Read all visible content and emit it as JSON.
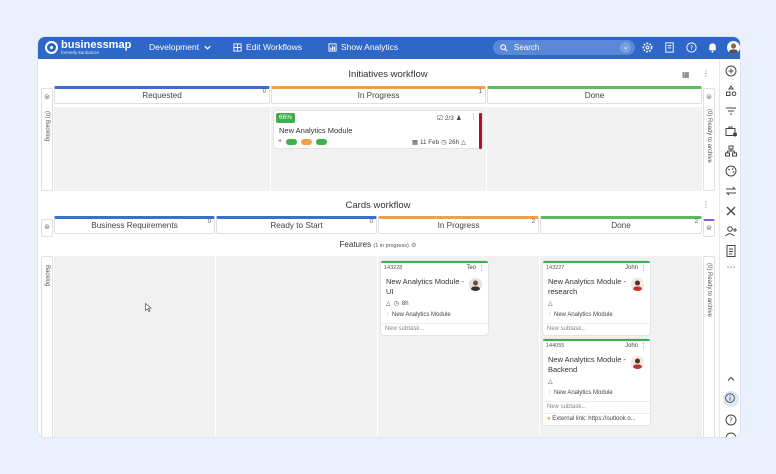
{
  "topbar": {
    "logo_text": "businessmap",
    "logo_sub": "formerly kanbanize",
    "nav_development": "Development",
    "nav_edit_workflows": "Edit Workflows",
    "nav_show_analytics": "Show Analytics",
    "search_placeholder": "Search"
  },
  "initiatives": {
    "title": "Initiatives workflow",
    "columns": [
      {
        "label": "Requested",
        "count": "0",
        "color": "#3a6fd0"
      },
      {
        "label": "In Progress",
        "count": "1",
        "color": "#f0a049"
      },
      {
        "label": "Done",
        "count": "",
        "color": "#5cba61"
      }
    ],
    "backlog_label": "(0) Backlog",
    "archive_label": "(0) Ready to archive",
    "card": {
      "progress": "66%",
      "progress_value": 0.66,
      "checklist": "2/3",
      "title": "New Analytics Module",
      "date": "11 Feb",
      "duration": "26h",
      "pill_colors": [
        "#3fae4c",
        "#f0a049",
        "#3fae4c"
      ],
      "accent": "#b0102a"
    }
  },
  "cards_workflow": {
    "title": "Cards workflow",
    "columns": [
      {
        "label": "Business Requirements",
        "count": "0",
        "color": "#3a6fd0"
      },
      {
        "label": "Ready to Start",
        "count": "0",
        "color": "#3a6fd0"
      },
      {
        "label": "In Progress",
        "count": "2",
        "color": "#f0a049"
      },
      {
        "label": "Done",
        "count": "2",
        "color": "#5cba61"
      }
    ],
    "lane_title": "Features",
    "lane_sub": "(1 in progress)",
    "backlog_label": "Backlog",
    "archive_label": "(0) Ready to archive",
    "cards": [
      {
        "id": "143228",
        "owner": "Teo",
        "title1": "New Analytics Module -",
        "title2": "UI",
        "time": "8h",
        "parent": "New Analytics Module",
        "subtask": "New subtask..."
      },
      {
        "id": "143227",
        "owner": "John",
        "title1": "New Analytics Module -",
        "title2": "research",
        "parent": "New Analytics Module",
        "subtask": "New subtask..."
      },
      {
        "id": "144055",
        "owner": "John",
        "title1": "New Analytics Module -",
        "title2": "Backend",
        "parent": "New Analytics Module",
        "subtask": "New subtask...",
        "link": "External link: https://outlook.o..."
      }
    ]
  }
}
